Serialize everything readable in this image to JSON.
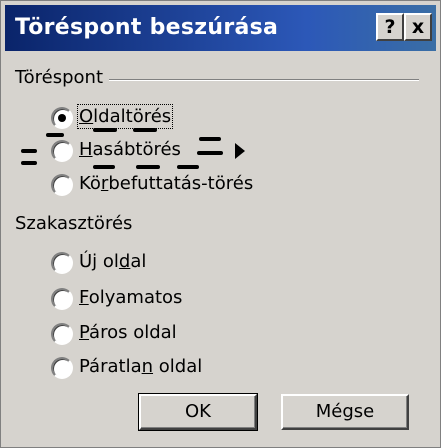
{
  "window": {
    "title": "Töréspont beszúrása",
    "help_glyph": "?",
    "close_glyph": "x"
  },
  "breaks": {
    "group_label": "Töréspont",
    "options": [
      {
        "label": "Oldaltörés",
        "mnemonic": "O",
        "selected": true
      },
      {
        "label": "Hasábtörés",
        "mnemonic": "H",
        "selected": false
      },
      {
        "label": "Körbefuttatás-törés",
        "mnemonic": "r",
        "selected": false
      }
    ]
  },
  "section_breaks": {
    "group_label": "Szakasztörés",
    "options": [
      {
        "label": "Új oldal",
        "mnemonic": "d",
        "selected": false
      },
      {
        "label": "Folyamatos",
        "mnemonic": "F",
        "selected": false
      },
      {
        "label": "Páros oldal",
        "mnemonic": "P",
        "selected": false
      },
      {
        "label": "Páratlan oldal",
        "mnemonic": "n",
        "selected": false
      }
    ]
  },
  "buttons": {
    "ok": "OK",
    "cancel": "Mégse"
  },
  "colors": {
    "title_start": "#0a246a",
    "title_end": "#3a6ea5",
    "face": "#d6d3ce"
  }
}
